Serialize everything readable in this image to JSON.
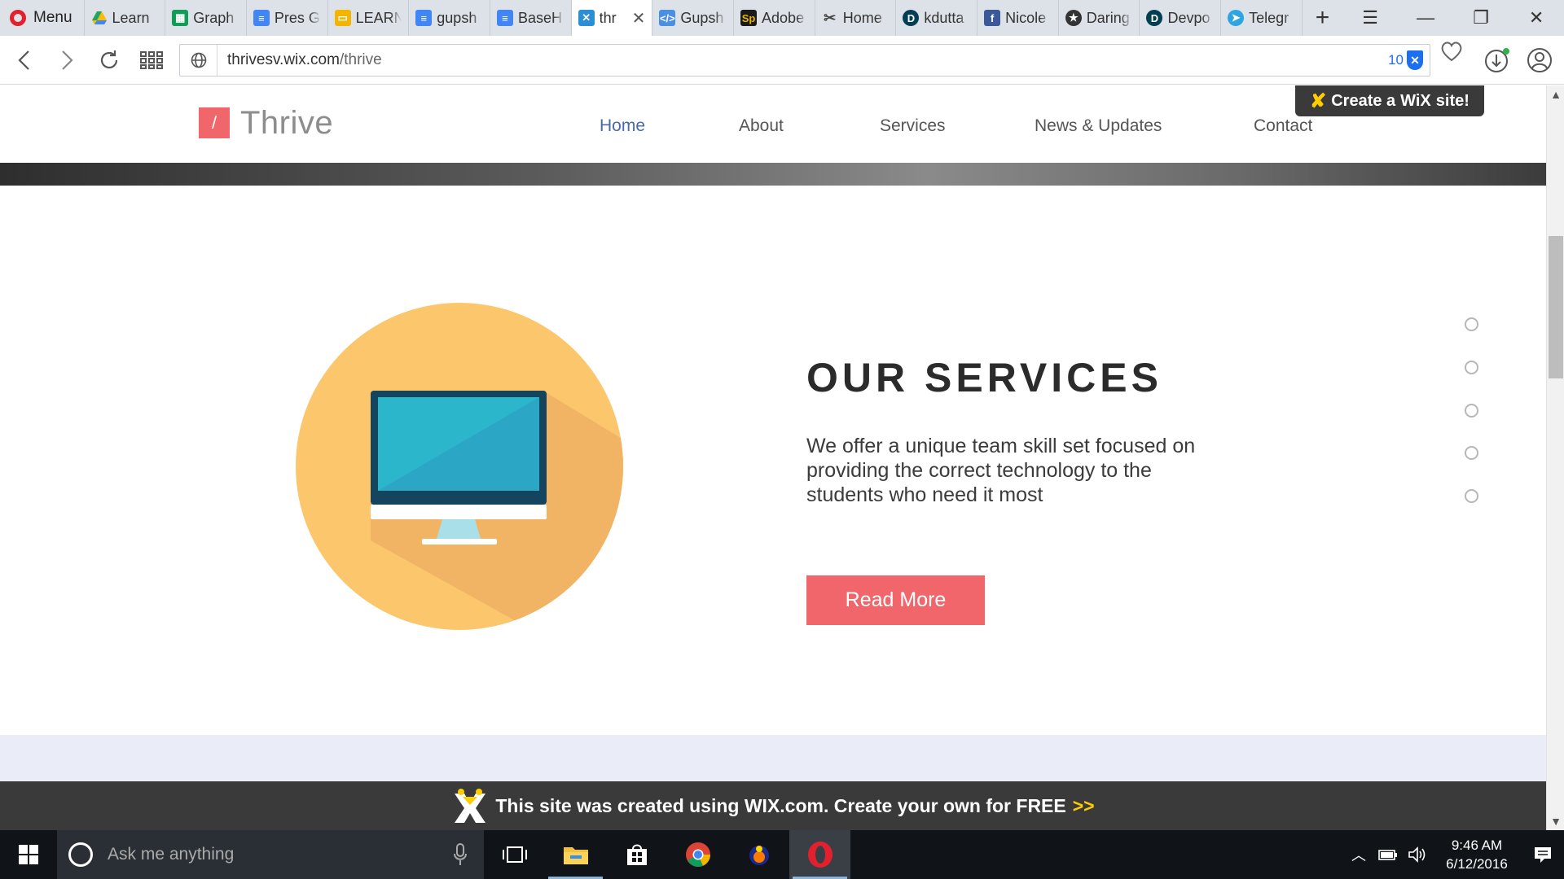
{
  "browser": {
    "menu_label": "Menu",
    "tabs": [
      {
        "label": "Learn",
        "icon": "google-drive-icon",
        "color": "#1fa463"
      },
      {
        "label": "Graph",
        "icon": "google-sheets-icon",
        "color": "#0f9d58"
      },
      {
        "label": "Pres G",
        "icon": "google-docs-icon",
        "color": "#4285f4"
      },
      {
        "label": "LEARN",
        "icon": "google-slides-icon",
        "color": "#f4b400"
      },
      {
        "label": "gupsh",
        "icon": "google-docs-icon",
        "color": "#4285f4"
      },
      {
        "label": "BaseH",
        "icon": "google-docs-icon",
        "color": "#4285f4"
      },
      {
        "label": "thr",
        "icon": "wix-icon",
        "color": "#2a8fd6",
        "active": true
      },
      {
        "label": "Gupsh",
        "icon": "code-icon",
        "color": "#4a90e2"
      },
      {
        "label": "Adobe",
        "icon": "adobe-spark-icon",
        "color": "#e8b400"
      },
      {
        "label": "Home",
        "icon": "tools-icon",
        "color": "#444444"
      },
      {
        "label": "kdutta",
        "icon": "devpost-icon",
        "color": "#003e54"
      },
      {
        "label": "Nicole",
        "icon": "facebook-icon",
        "color": "#3b5998"
      },
      {
        "label": "Daring",
        "icon": "star-icon",
        "color": "#333333"
      },
      {
        "label": "Devpo",
        "icon": "devpost-icon",
        "color": "#003e54"
      },
      {
        "label": "Telegr",
        "icon": "telegram-icon",
        "color": "#2ca5e0"
      }
    ],
    "url_host": "thrivesv.wix.com",
    "url_path": "/thrive",
    "adblock_count": "10",
    "adblock_glyph": "✕"
  },
  "site": {
    "logo_mark": "/",
    "logo_text": "Thrive",
    "nav": [
      {
        "label": "Home",
        "current": true
      },
      {
        "label": "About"
      },
      {
        "label": "Services"
      },
      {
        "label": "News & Updates"
      },
      {
        "label": "Contact"
      }
    ],
    "wix_badge": {
      "pre": "Create a",
      "brand": "WiX",
      "post": "site!"
    },
    "services": {
      "title": "OUR SERVICES",
      "text": "We offer a unique team skill set focused on providing the correct technology to the students who need it most",
      "button": "Read More"
    },
    "footer_banner": {
      "text": "This site was created using WIX.com. Create your own for FREE",
      "arrow": ">>"
    },
    "colors": {
      "accent": "#f1666a",
      "nav_active": "#4a6aa5",
      "circle": "#fcc66c"
    }
  },
  "taskbar": {
    "search_placeholder": "Ask me anything",
    "time": "9:46 AM",
    "date": "6/12/2016"
  }
}
